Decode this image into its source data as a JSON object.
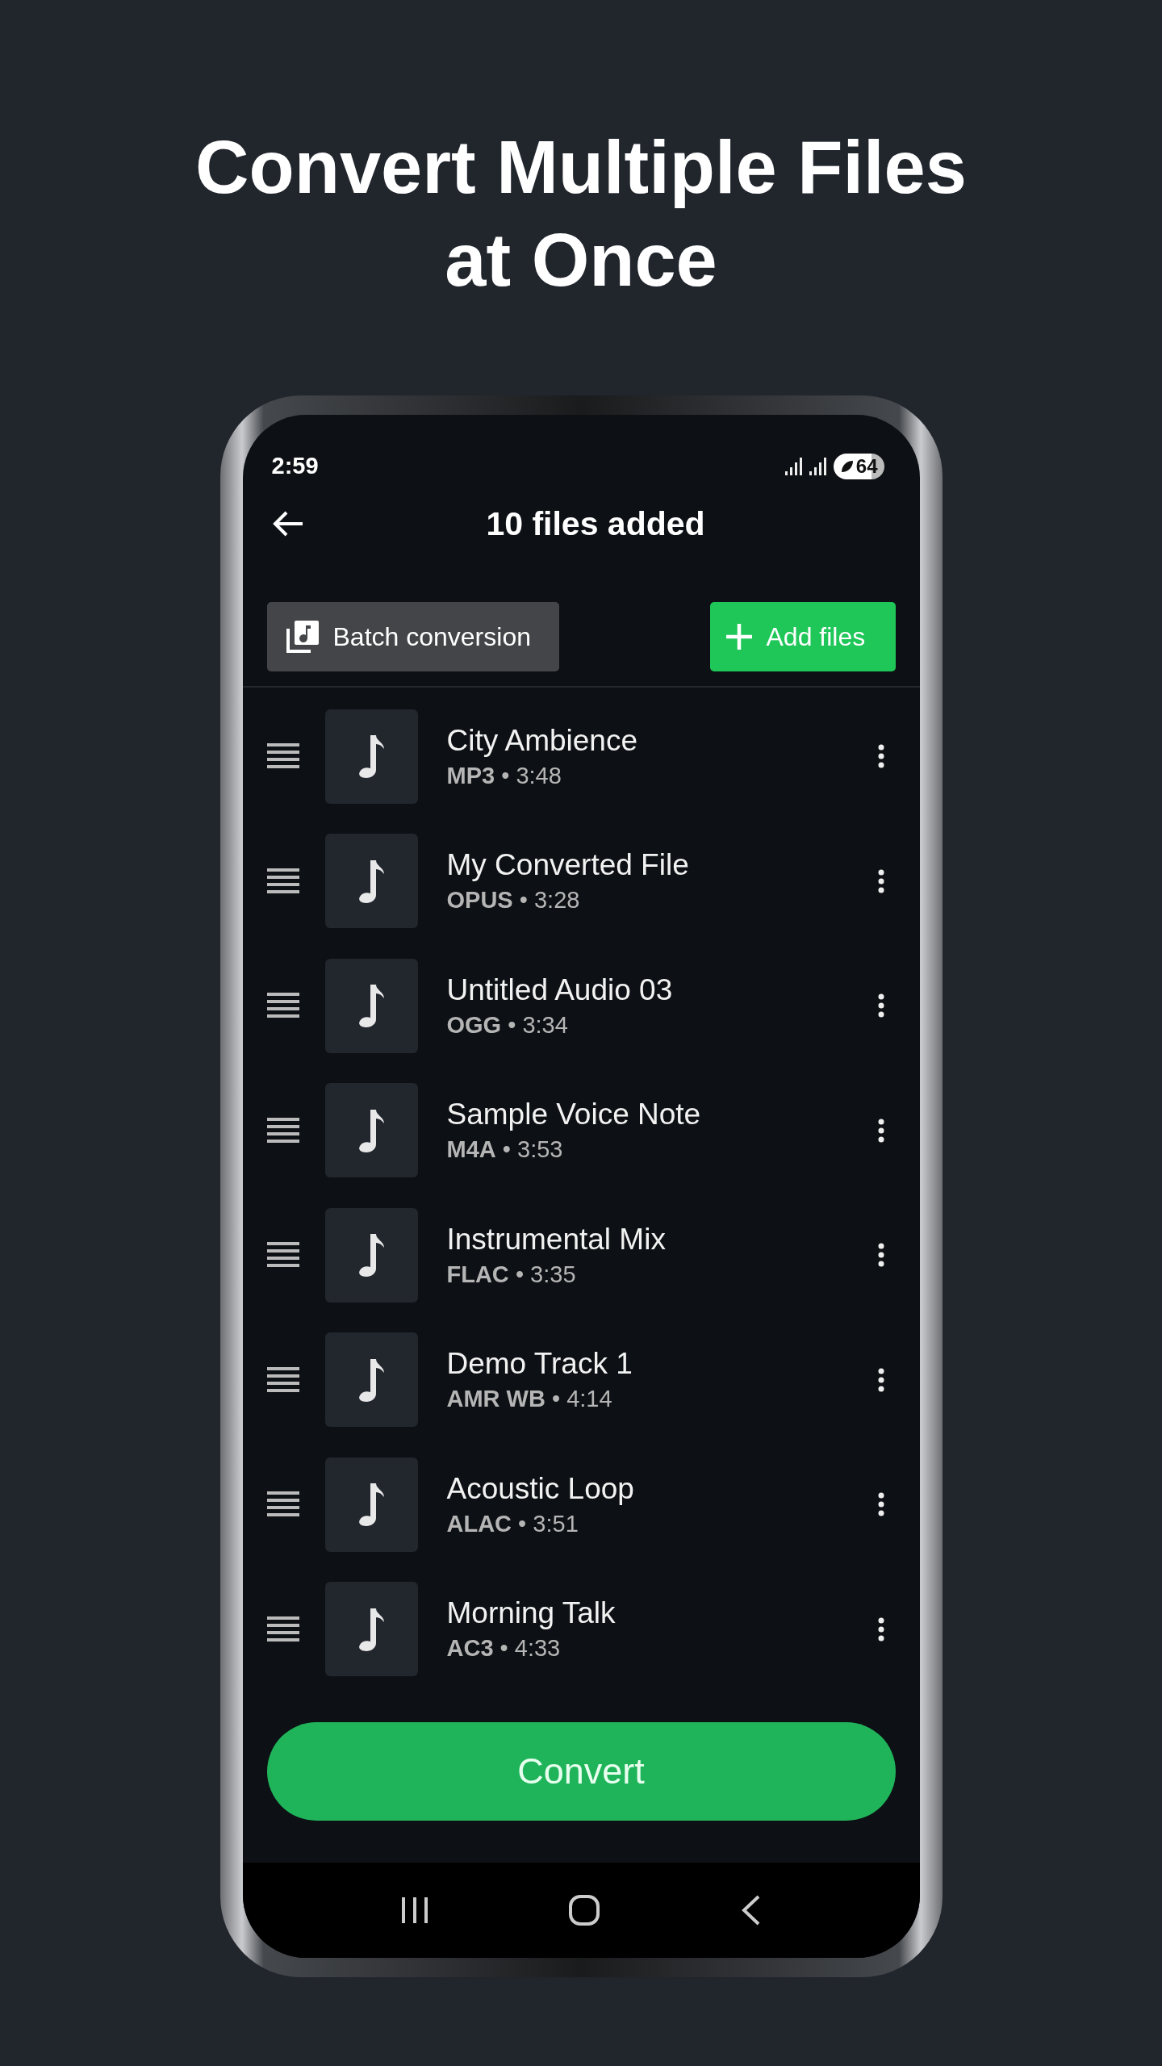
{
  "headline": [
    "Convert Multiple Files",
    "at Once"
  ],
  "status_bar": {
    "time": "2:59",
    "battery": "64"
  },
  "app_bar": {
    "title": "10 files added"
  },
  "toolbar": {
    "batch_button": "Batch conversion",
    "add_button": "Add files"
  },
  "files": [
    {
      "name": "City Ambience",
      "details": "**MP3** • 3:48"
    },
    {
      "name": "My Converted File",
      "details": "**OPUS** • 3:28"
    },
    {
      "name": "Untitled Audio 03",
      "details": "**OGG** • 3:34"
    },
    {
      "name": "Sample Voice Note",
      "details": "**M4A** • 3:53"
    },
    {
      "name": "Instrumental Mix",
      "details": "**FLAC** • 3:35"
    },
    {
      "name": "Demo Track 1",
      "details": "**AMR WB** • 4:14"
    },
    {
      "name": "Acoustic Loop",
      "details": "**ALAC** • 3:51"
    },
    {
      "name": "Morning Talk",
      "details": "**AC3** • 4:33"
    }
  ],
  "convert_button": "Convert"
}
